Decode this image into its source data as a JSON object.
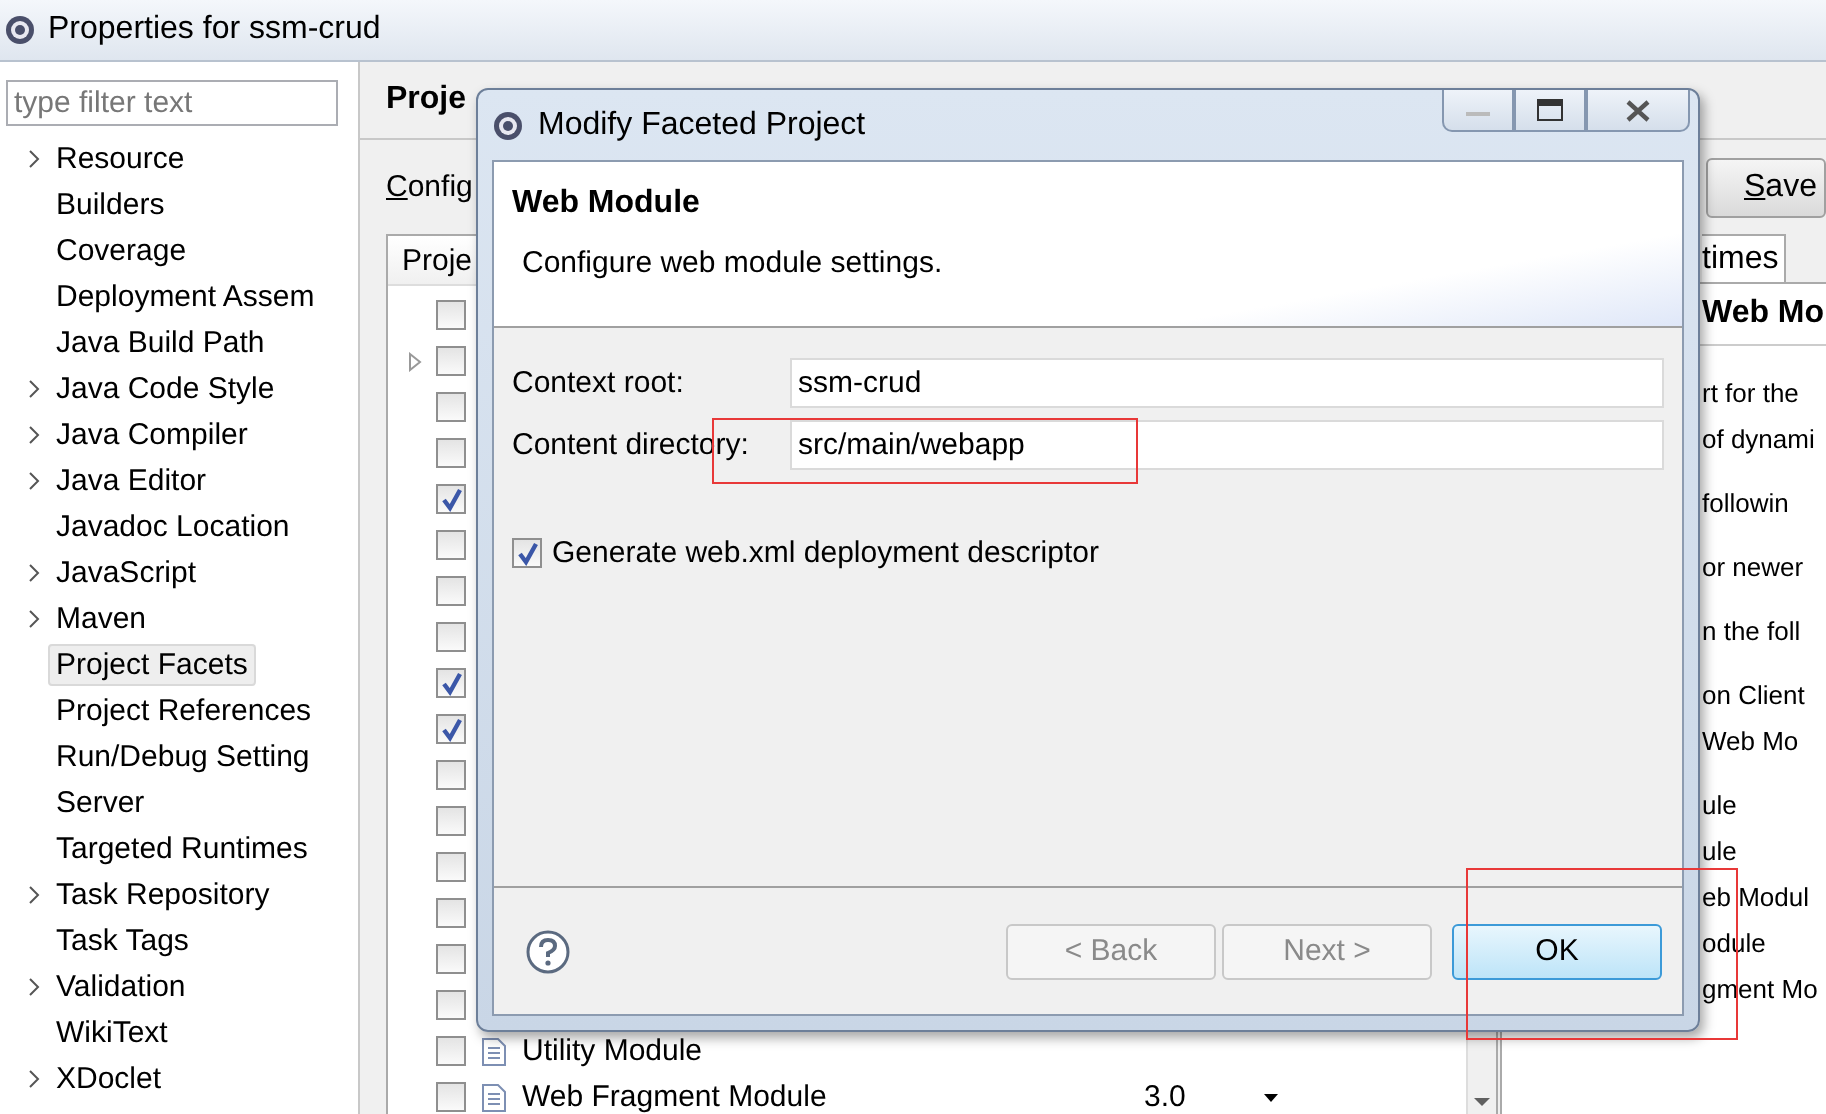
{
  "window": {
    "title": "Properties for ssm-crud"
  },
  "sidebar": {
    "filter": {
      "placeholder": "type filter text"
    },
    "items": [
      {
        "label": "Resource",
        "expandable": true,
        "selected": false
      },
      {
        "label": "Builders",
        "expandable": false,
        "selected": false
      },
      {
        "label": "Coverage",
        "expandable": false,
        "selected": false
      },
      {
        "label": "Deployment Assem",
        "expandable": false,
        "selected": false
      },
      {
        "label": "Java Build Path",
        "expandable": false,
        "selected": false
      },
      {
        "label": "Java Code Style",
        "expandable": true,
        "selected": false
      },
      {
        "label": "Java Compiler",
        "expandable": true,
        "selected": false
      },
      {
        "label": "Java Editor",
        "expandable": true,
        "selected": false
      },
      {
        "label": "Javadoc Location",
        "expandable": false,
        "selected": false
      },
      {
        "label": "JavaScript",
        "expandable": true,
        "selected": false
      },
      {
        "label": "Maven",
        "expandable": true,
        "selected": false
      },
      {
        "label": "Project Facets",
        "expandable": false,
        "selected": true
      },
      {
        "label": "Project References",
        "expandable": false,
        "selected": false
      },
      {
        "label": "Run/Debug Setting",
        "expandable": false,
        "selected": false
      },
      {
        "label": "Server",
        "expandable": false,
        "selected": false
      },
      {
        "label": "Targeted Runtimes",
        "expandable": false,
        "selected": false
      },
      {
        "label": "Task Repository",
        "expandable": true,
        "selected": false
      },
      {
        "label": "Task Tags",
        "expandable": false,
        "selected": false
      },
      {
        "label": "Validation",
        "expandable": true,
        "selected": false
      },
      {
        "label": "WikiText",
        "expandable": false,
        "selected": false
      },
      {
        "label": "XDoclet",
        "expandable": true,
        "selected": false
      }
    ]
  },
  "main": {
    "title": "Proje",
    "configuration_label": "Config",
    "save_button": "Save",
    "table": {
      "column_1": "Proje",
      "rows": [
        {
          "checked": false,
          "expandable": false
        },
        {
          "checked": false,
          "expandable": true
        },
        {
          "checked": false,
          "expandable": false
        },
        {
          "checked": false,
          "expandable": false
        },
        {
          "checked": true,
          "expandable": false
        },
        {
          "checked": false,
          "expandable": false
        },
        {
          "checked": false,
          "expandable": false
        },
        {
          "checked": false,
          "expandable": false
        },
        {
          "checked": true,
          "expandable": false
        },
        {
          "checked": true,
          "expandable": false
        },
        {
          "checked": false,
          "expandable": false
        },
        {
          "checked": false,
          "expandable": false
        },
        {
          "checked": false,
          "expandable": false
        },
        {
          "checked": false,
          "expandable": false
        },
        {
          "checked": false,
          "expandable": false
        },
        {
          "checked": false,
          "expandable": false
        },
        {
          "checked": false,
          "expandable": false,
          "name": "Utility Module"
        },
        {
          "checked": false,
          "expandable": false,
          "name": "Web Fragment Module",
          "version": "3.0"
        }
      ]
    },
    "details": {
      "tab": "times",
      "title": "Web Mo",
      "paragraphs": [
        [
          "rt for the",
          "of dynami"
        ],
        [
          "followin"
        ],
        [
          "or newer"
        ],
        [
          "n the foll"
        ],
        [
          "on Client",
          "Web Mo"
        ],
        [
          "ule",
          "ule",
          "eb Modul",
          "odule",
          "gment Mo"
        ]
      ]
    }
  },
  "dialog": {
    "title": "Modify Faceted Project",
    "heading": "Web Module",
    "description": "Configure web module settings.",
    "fields": [
      {
        "label": "Context root:",
        "value": "ssm-crud",
        "highlighted": false
      },
      {
        "label": "Content directory:",
        "value": "src/main/webapp",
        "highlighted": true
      }
    ],
    "generate_descriptor": {
      "label": "Generate web.xml deployment descriptor",
      "checked": true
    },
    "buttons": [
      {
        "label": "< Back",
        "kind": "nav",
        "disabled": true,
        "highlighted": false
      },
      {
        "label": "Next >",
        "kind": "nav",
        "disabled": true,
        "highlighted": false
      },
      {
        "label": "OK",
        "kind": "default",
        "disabled": false,
        "highlighted": true
      }
    ]
  }
}
